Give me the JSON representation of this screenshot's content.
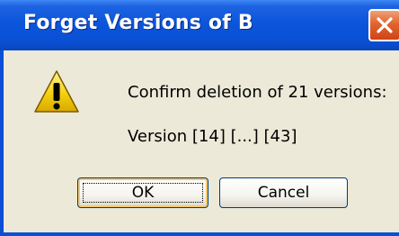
{
  "window": {
    "title": "Forget Versions of B"
  },
  "dialog": {
    "icon": "warning-icon",
    "message": "Confirm deletion of 21 versions:",
    "detail": "Version  [14] [...] [43]"
  },
  "buttons": {
    "ok_label": "OK",
    "cancel_label": "Cancel"
  },
  "colors": {
    "titlebar": "#0a50d4",
    "close_button": "#e2642e",
    "dialog_background": "#ece9d8",
    "warning_yellow": "#f5d10f"
  }
}
